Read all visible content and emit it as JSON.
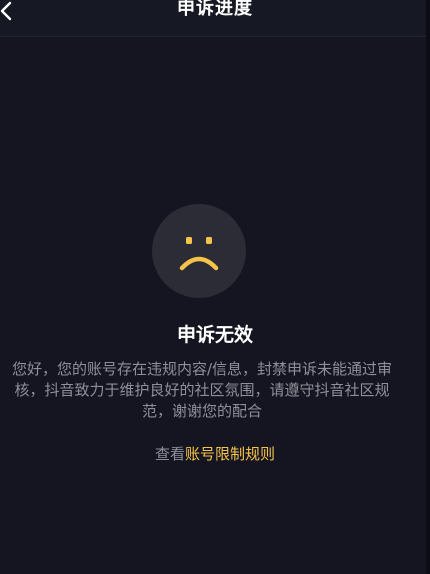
{
  "nav": {
    "title": "申诉进度",
    "back_icon": "chevron-left-icon"
  },
  "status": {
    "icon": "sad-face-icon",
    "icon_color": "#f7c34a",
    "title": "申诉无效",
    "description": "您好，您的账号存在违规内容/信息，封禁申诉未能通过审核，抖音致力于维护良好的社区氛围，请遵守抖音社区规范，谢谢您的配合"
  },
  "rules": {
    "prefix": "查看",
    "link_label": "账号限制规则",
    "link_color": "#f7c34a"
  }
}
